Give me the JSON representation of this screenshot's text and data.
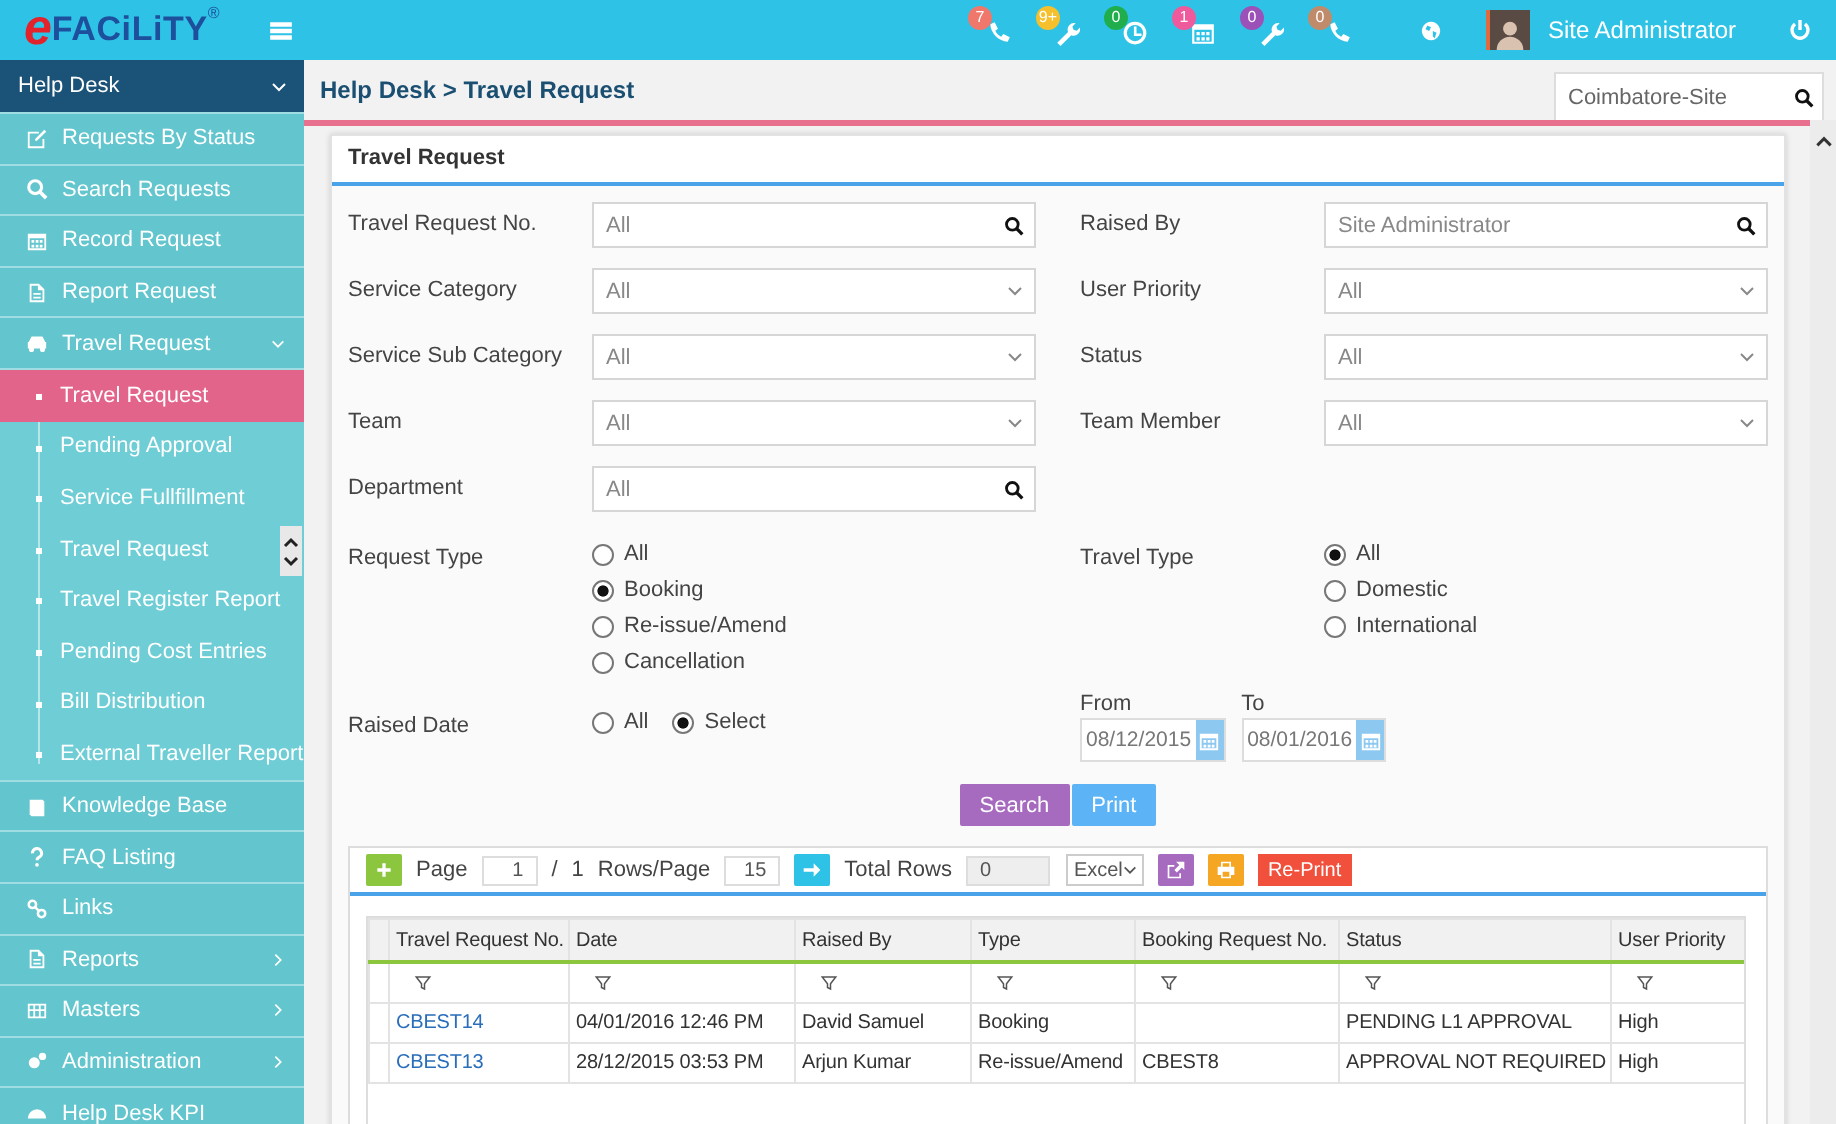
{
  "header": {
    "logo": {
      "letter": "e",
      "word": "FACiLiTY",
      "mark": "®"
    },
    "alerts": [
      {
        "count": "7",
        "color": "#f0776b"
      },
      {
        "count": "9+",
        "color": "#f5c02c"
      },
      {
        "count": "0",
        "color": "#1fae4b"
      },
      {
        "count": "1",
        "color": "#ee5a9c"
      },
      {
        "count": "0",
        "color": "#9b51b8"
      },
      {
        "count": "0",
        "color": "#c08b6b"
      }
    ],
    "user": "Site Administrator"
  },
  "sidebar": {
    "module": "Help Desk",
    "items": [
      {
        "label": "Requests By Status",
        "kind": "link"
      },
      {
        "label": "Search Requests",
        "kind": "link"
      },
      {
        "label": "Record Request",
        "kind": "link"
      },
      {
        "label": "Report Request",
        "kind": "link"
      },
      {
        "label": "Travel Request",
        "kind": "menu",
        "expanded": true,
        "children": [
          {
            "label": "Travel Request",
            "selected": true
          },
          {
            "label": "Pending Approval",
            "selected": false
          },
          {
            "label": "Service Fullfillment",
            "selected": false
          },
          {
            "label": "Travel Request",
            "selected": false
          },
          {
            "label": "Travel Register Report",
            "selected": false
          },
          {
            "label": "Pending Cost Entries",
            "selected": false
          },
          {
            "label": "Bill Distribution",
            "selected": false
          },
          {
            "label": "External Traveller Report",
            "selected": false
          }
        ]
      },
      {
        "label": "Knowledge Base",
        "kind": "link"
      },
      {
        "label": "FAQ Listing",
        "kind": "link"
      },
      {
        "label": "Links",
        "kind": "link"
      },
      {
        "label": "Reports",
        "kind": "menu",
        "expanded": false
      },
      {
        "label": "Masters",
        "kind": "menu",
        "expanded": false
      },
      {
        "label": "Administration",
        "kind": "menu",
        "expanded": false
      },
      {
        "label": "Help Desk KPI",
        "kind": "link"
      }
    ]
  },
  "breadcrumb": "Help Desk > Travel Request",
  "site_search": {
    "value": "Coimbatore-Site"
  },
  "form": {
    "title": "Travel Request",
    "fields": [
      {
        "label": "Travel Request No.",
        "value": "All",
        "kind": "search"
      },
      {
        "label": "Raised By",
        "value": "Site Administrator",
        "kind": "search"
      },
      {
        "label": "Service Category",
        "value": "All",
        "kind": "select"
      },
      {
        "label": "User Priority",
        "value": "All",
        "kind": "select"
      },
      {
        "label": "Service Sub Category",
        "value": "All",
        "kind": "select"
      },
      {
        "label": "Status",
        "value": "All",
        "kind": "select"
      },
      {
        "label": "Team",
        "value": "All",
        "kind": "select"
      },
      {
        "label": "Team Member",
        "value": "All",
        "kind": "select"
      },
      {
        "label": "Department",
        "value": "All",
        "kind": "search"
      }
    ],
    "request_type": {
      "label": "Request Type",
      "options": [
        {
          "label": "All",
          "selected": false
        },
        {
          "label": "Booking",
          "selected": true
        },
        {
          "label": "Re-issue/Amend",
          "selected": false
        },
        {
          "label": "Cancellation",
          "selected": false
        }
      ]
    },
    "travel_type": {
      "label": "Travel Type",
      "options": [
        {
          "label": "All",
          "selected": true
        },
        {
          "label": "Domestic",
          "selected": false
        },
        {
          "label": "International",
          "selected": false
        }
      ]
    },
    "raised_date": {
      "label": "Raised Date",
      "options": [
        {
          "label": "All",
          "selected": false
        },
        {
          "label": "Select",
          "selected": true
        }
      ]
    },
    "from": {
      "label": "From",
      "value": "08/12/2015"
    },
    "to": {
      "label": "To",
      "value": "08/01/2016"
    },
    "buttons": [
      "Search",
      "Print"
    ]
  },
  "grid": {
    "toolbar": {
      "page_label": "Page",
      "page": "1",
      "separator": "/",
      "page_count": "1",
      "rows_label": "Rows/Page",
      "rows_per_page": "15",
      "total_label": "Total Rows",
      "total": "0",
      "export_format": "Excel",
      "reprint": "Re-Print"
    },
    "columns": [
      "Travel Request No.",
      "Date",
      "Raised By",
      "Type",
      "Booking Request No.",
      "Status",
      "User Priority"
    ],
    "rows": [
      [
        "CBEST14",
        "04/01/2016 12:46 PM",
        "David Samuel",
        "Booking",
        "",
        "PENDING L1 APPROVAL",
        "High"
      ],
      [
        "CBEST13",
        "28/12/2015 03:53 PM",
        "Arjun Kumar",
        "Re-issue/Amend",
        "CBEST8",
        "APPROVAL NOT REQUIRED",
        "High"
      ]
    ]
  }
}
